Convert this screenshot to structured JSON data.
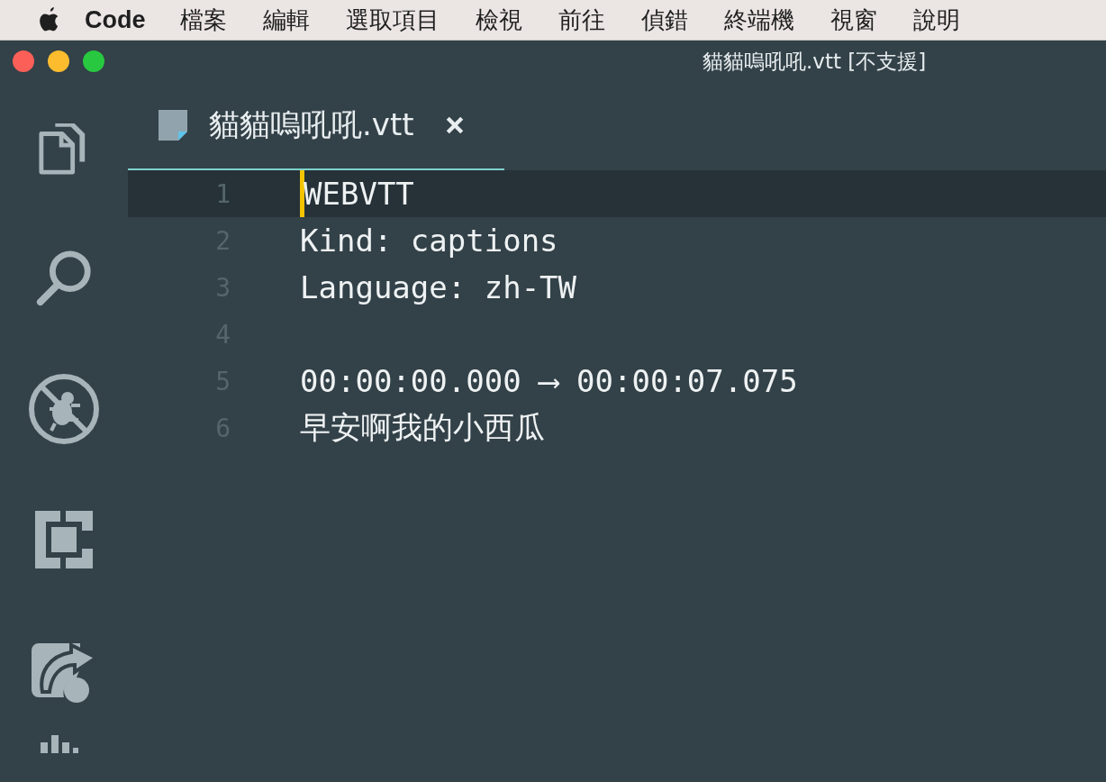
{
  "menu_bar": {
    "app_name": "Code",
    "items": [
      "檔案",
      "編輯",
      "選取項目",
      "檢視",
      "前往",
      "偵錯",
      "終端機",
      "視窗",
      "說明"
    ]
  },
  "window": {
    "title": "貓貓嗚吼吼.vtt [不支援]"
  },
  "tabs": [
    {
      "label": "貓貓嗚吼吼.vtt",
      "selected": true
    }
  ],
  "editor": {
    "lines": [
      {
        "number": "1",
        "text": "WEBVTT",
        "current": true
      },
      {
        "number": "2",
        "text": "Kind: captions",
        "current": false
      },
      {
        "number": "3",
        "text": "Language: zh-TW",
        "current": false
      },
      {
        "number": "4",
        "current": false
      },
      {
        "number": "5",
        "text": "00:00:00.000 ⟶ 00:00:07.075",
        "current": false
      },
      {
        "number": "6",
        "text": "早安啊我的小西瓜",
        "current": false
      }
    ]
  }
}
